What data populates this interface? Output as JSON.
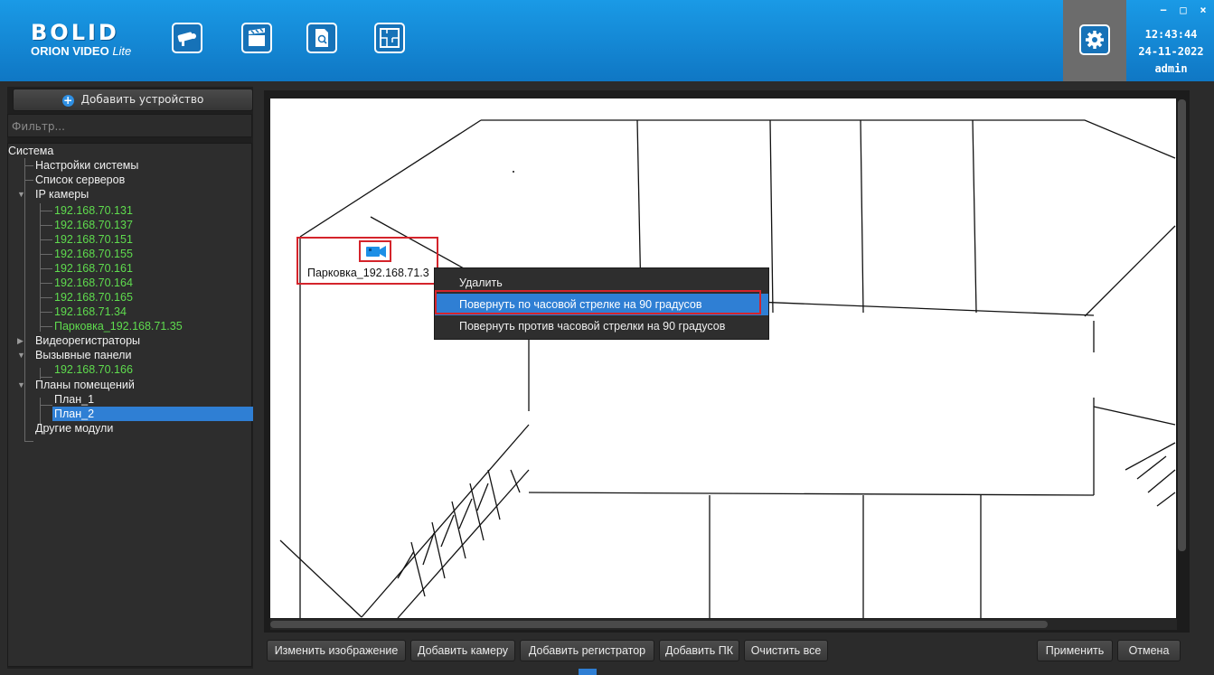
{
  "header": {
    "logo_main": "BOLID",
    "logo_sub": "ORION VIDEO",
    "logo_sub_italic": "Lite",
    "tools": [
      "camera-tool-icon",
      "clapper-tool-icon",
      "document-search-tool-icon",
      "floor-plan-tool-icon"
    ],
    "settings_icon": "gear-icon",
    "window_controls": [
      "−",
      "□",
      "×"
    ],
    "time": "12:43:44",
    "date": "24-11-2022",
    "user": "admin",
    "accent": "#1a8fdc"
  },
  "sidebar": {
    "add_device": "Добавить устройство",
    "filter_placeholder": "Фильтр...",
    "tree": {
      "root": "Система",
      "settings": "Настройки системы",
      "servers": "Список серверов",
      "ip_cameras": "IP камеры",
      "cameras": [
        "192.168.70.131",
        "192.168.70.137",
        "192.168.70.151",
        "192.168.70.155",
        "192.168.70.161",
        "192.168.70.164",
        "192.168.70.165",
        "192.168.71.34",
        "Парковка_192.168.71.35"
      ],
      "recorders": "Видеорегистраторы",
      "call_panels": "Вызывные панели",
      "call_panel_items": [
        "192.168.70.166"
      ],
      "floor_plans": "Планы помещений",
      "plans": [
        "План_1",
        "План_2"
      ],
      "other_modules": "Другие модули"
    }
  },
  "plan": {
    "camera_label": "Парковка_192.168.71.3",
    "camera_color": "#1d8fe6",
    "highlight_color": "#d4242b"
  },
  "context_menu": {
    "items": [
      "Удалить",
      "Повернуть по часовой стрелке на 90 градусов",
      "Повернуть против часовой стрелки на 90 градусов"
    ],
    "highlighted_index": 1
  },
  "toolbar": {
    "change_image": "Изменить изображение",
    "add_camera": "Добавить камеру",
    "add_recorder": "Добавить регистратор",
    "add_pc": "Добавить ПК",
    "clear_all": "Очистить все",
    "apply": "Применить",
    "cancel": "Отмена"
  }
}
